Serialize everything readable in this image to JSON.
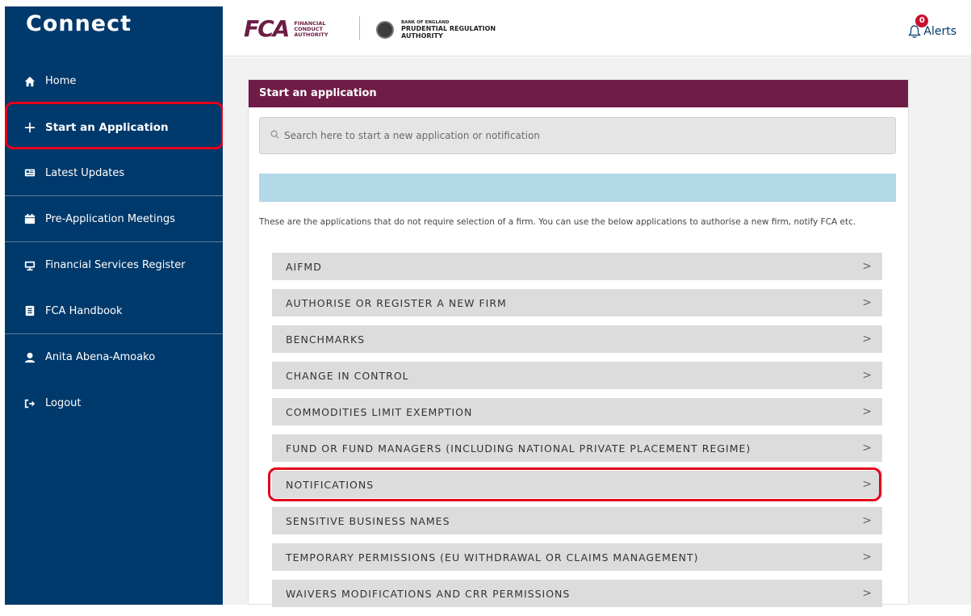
{
  "app": {
    "title": "Connect"
  },
  "sidebar": {
    "items": [
      {
        "label": "Home",
        "icon": "home-icon"
      },
      {
        "label": "Start an Application",
        "icon": "plus-icon"
      },
      {
        "label": "Latest Updates",
        "icon": "newspaper-icon"
      },
      {
        "label": "Pre-Application Meetings",
        "icon": "calendar-icon"
      },
      {
        "label": "Financial Services Register",
        "icon": "monitor-icon"
      },
      {
        "label": "FCA Handbook",
        "icon": "book-icon"
      },
      {
        "label": "Anita Abena-Amoako",
        "icon": "user-icon"
      },
      {
        "label": "Logout",
        "icon": "logout-icon"
      }
    ]
  },
  "header": {
    "fca_mark": "FCA",
    "fca_text": [
      "FINANCIAL",
      "CONDUCT",
      "AUTHORITY"
    ],
    "boe_small": "BANK OF ENGLAND",
    "boe_big_1": "PRUDENTIAL REGULATION",
    "boe_big_2": "AUTHORITY",
    "alerts_label": "Alerts",
    "alerts_count": "0"
  },
  "panel": {
    "title": "Start an application",
    "search_placeholder": "Search here to start a new application or notification",
    "intro": "These are the applications that do not require selection of a firm. You can use the below applications to authorise a new firm, notify FCA etc.",
    "applications": [
      "AIFMD",
      "AUTHORISE OR REGISTER A NEW FIRM",
      "BENCHMARKS",
      "CHANGE IN CONTROL",
      "COMMODITIES LIMIT EXEMPTION",
      "FUND OR FUND MANAGERS (INCLUDING NATIONAL PRIVATE PLACEMENT REGIME)",
      "NOTIFICATIONS",
      "SENSITIVE BUSINESS NAMES",
      "TEMPORARY PERMISSIONS (EU WITHDRAWAL OR CLAIMS MANAGEMENT)",
      "WAIVERS MODIFICATIONS AND CRR PERMISSIONS"
    ]
  },
  "colors": {
    "sidebar": "#00396b",
    "panel_header": "#6f1c46",
    "highlight": "#e3001b",
    "band": "#b3d8e7"
  }
}
